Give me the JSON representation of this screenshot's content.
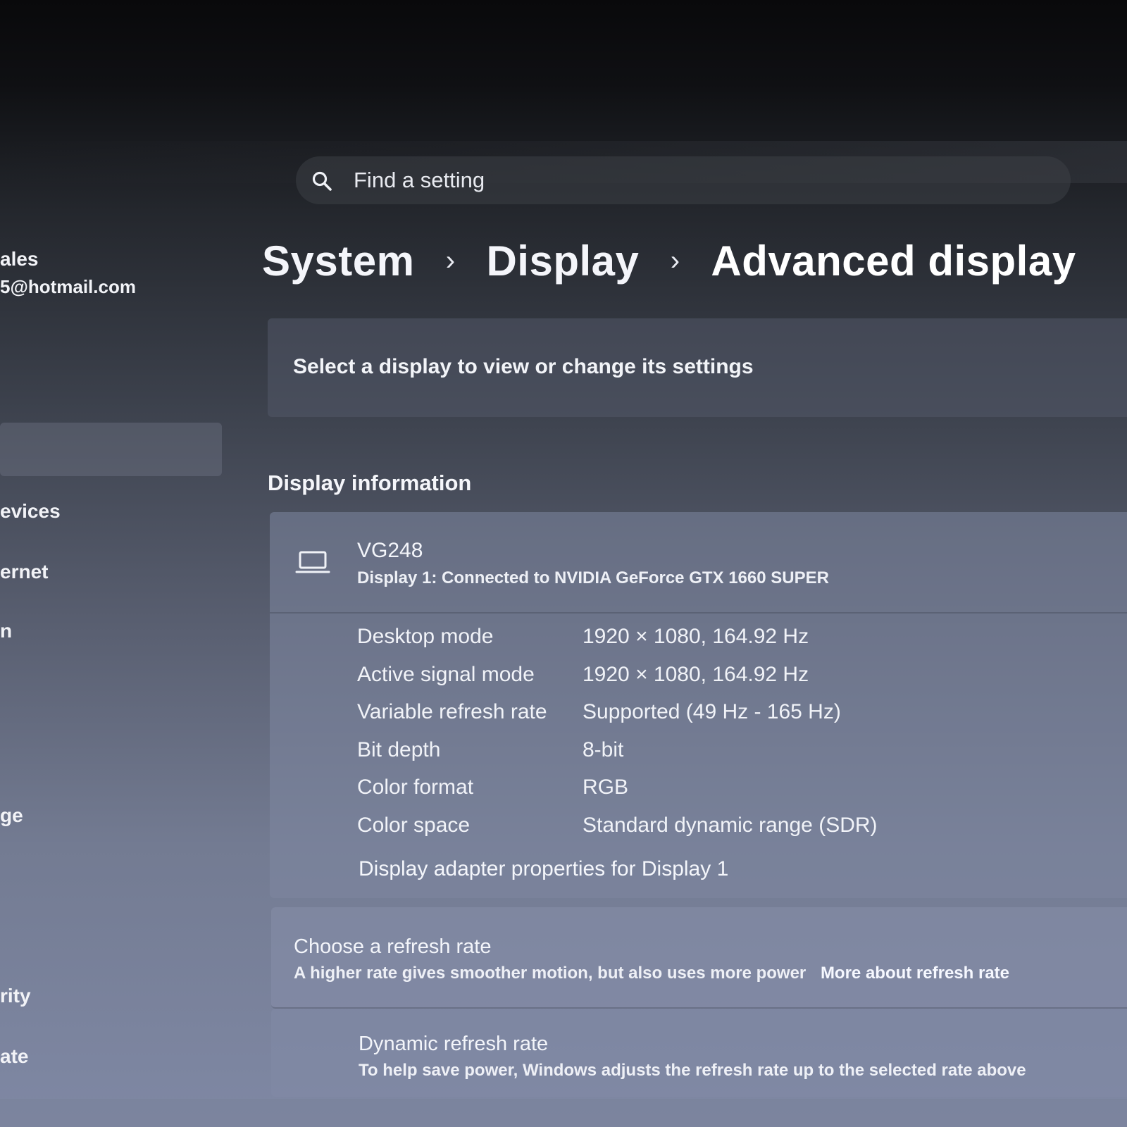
{
  "search": {
    "placeholder": "Find a setting"
  },
  "account": {
    "name_fragment": "ales",
    "email_fragment": "5@hotmail.com"
  },
  "sidebar": {
    "items": [
      {
        "label": "evices"
      },
      {
        "label": "ernet"
      },
      {
        "label": "n"
      },
      {
        "label": "ge"
      },
      {
        "label": "rity"
      },
      {
        "label": "ate"
      }
    ]
  },
  "breadcrumb": {
    "items": [
      "System",
      "Display",
      "Advanced display"
    ]
  },
  "select_display": {
    "label": "Select a display to view or change its settings"
  },
  "display_info": {
    "section_title": "Display information",
    "name": "VG248",
    "connection": "Display 1: Connected to NVIDIA GeForce GTX 1660 SUPER",
    "rows": [
      {
        "key": "Desktop mode",
        "value": "1920 × 1080, 164.92 Hz"
      },
      {
        "key": "Active signal mode",
        "value": "1920 × 1080, 164.92 Hz"
      },
      {
        "key": "Variable refresh rate",
        "value": "Supported (49 Hz - 165 Hz)"
      },
      {
        "key": "Bit depth",
        "value": "8-bit"
      },
      {
        "key": "Color format",
        "value": "RGB"
      },
      {
        "key": "Color space",
        "value": "Standard dynamic range (SDR)"
      }
    ],
    "adapter_link": "Display adapter properties for Display 1"
  },
  "refresh_rate": {
    "title": "Choose a refresh rate",
    "description": "A higher rate gives smoother motion, but also uses more power",
    "link": "More about refresh rate"
  },
  "dynamic_refresh": {
    "title": "Dynamic refresh rate",
    "description": "To help save power, Windows adjusts the refresh rate up to the selected rate above"
  },
  "icons": {
    "search": "search-icon",
    "monitor": "laptop-icon",
    "chevron": "chevron-right-icon"
  }
}
